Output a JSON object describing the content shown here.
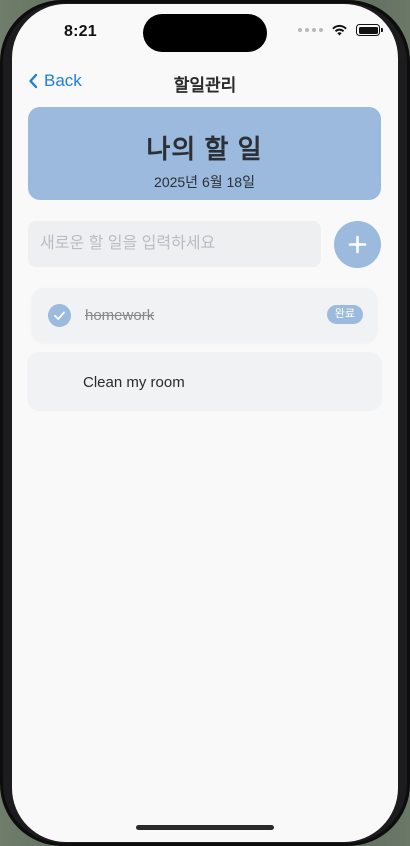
{
  "status_bar": {
    "time": "8:21"
  },
  "nav": {
    "back_label": "Back",
    "title": "할일관리"
  },
  "header": {
    "title": "나의 할 일",
    "date": "2025년 6월 18일"
  },
  "input": {
    "placeholder": "새로운 할 일을 입력하세요",
    "value": ""
  },
  "todos": [
    {
      "text": "homework",
      "completed": true,
      "badge": "완료"
    },
    {
      "text": "Clean my room",
      "completed": false
    }
  ],
  "colors": {
    "accent": "#9bbadd",
    "link": "#1a7fe0",
    "background": "#f9f9f9"
  },
  "icons": {
    "back": "chevron-left-icon",
    "add": "plus-icon",
    "check": "checkmark-icon"
  }
}
